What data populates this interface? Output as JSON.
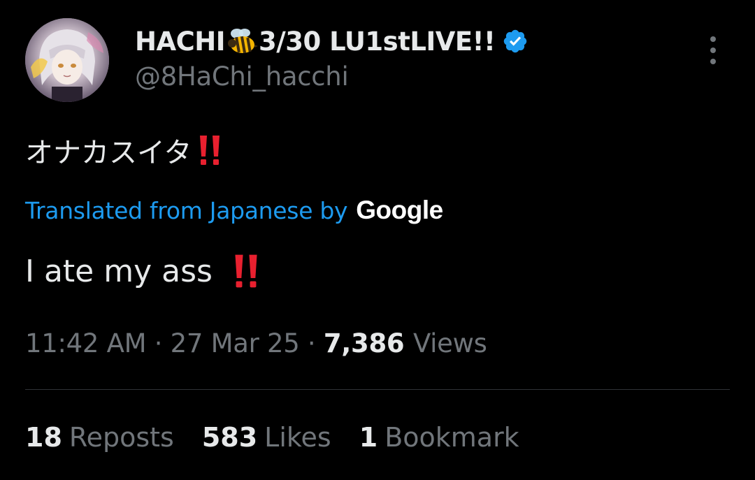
{
  "author": {
    "display_name_prefix": "HACHI",
    "display_name_icon": "bee-icon",
    "display_name_suffix": "3/30 LU1stLIVE!!",
    "verified_icon": "verified-badge-icon",
    "verified_color": "#1d9bf0",
    "handle": "@8HaChi_hacchi",
    "avatar": "avatar-image"
  },
  "menu": {
    "more_icon": "more-vertical-icon"
  },
  "tweet": {
    "original_text": "オナカスイタ",
    "original_emoji": "double-exclamation-icon",
    "translation_label": "Translated from Japanese by",
    "translation_provider": "Google",
    "translated_text": "I ate my ass",
    "translated_emoji": "double-exclamation-icon",
    "link_color": "#1d9bf0",
    "emoji_color": "#e8202f"
  },
  "meta": {
    "time": "11:42 AM",
    "separator": "·",
    "date": "27 Mar 25",
    "views_count": "7,386",
    "views_label": "Views"
  },
  "stats": {
    "reposts_count": "18",
    "reposts_label": "Reposts",
    "likes_count": "583",
    "likes_label": "Likes",
    "bookmarks_count": "1",
    "bookmarks_label": "Bookmark"
  }
}
